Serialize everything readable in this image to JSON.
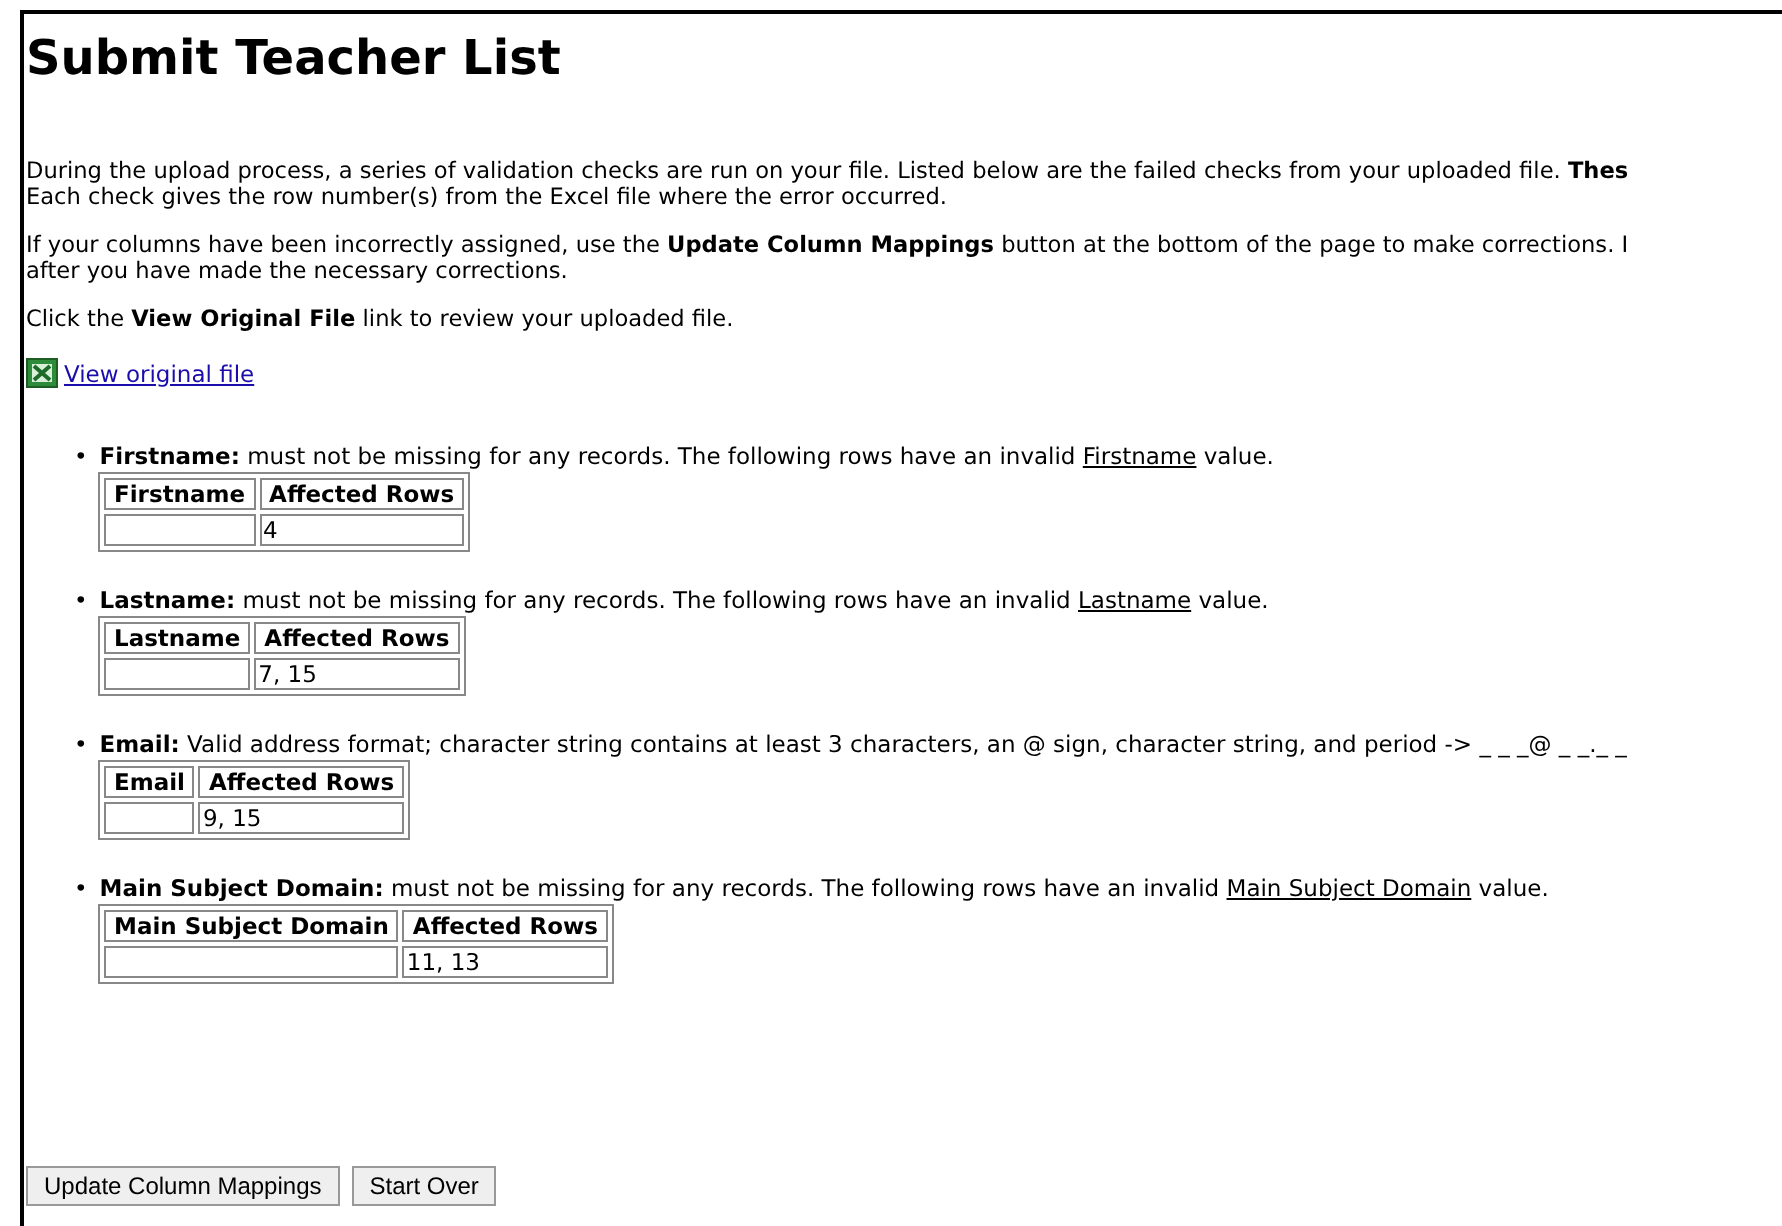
{
  "title": "Submit Teacher List",
  "paragraphs": [
    {
      "text": "During the upload process, a series of validation checks are run on your file. Listed below are the failed checks from your uploaded file. **Thes**\nEach check gives the row number(s) from the Excel file where the error occurred."
    },
    {
      "text": "If your columns have been incorrectly assigned, use the **Update Column Mappings** button at the bottom of the page to make corrections. I\nafter you have made the necessary corrections."
    },
    {
      "text": "Click the **View Original File** link to review your uploaded file."
    }
  ],
  "file_link": {
    "label": "View original file"
  },
  "checks": [
    {
      "marker": "•",
      "field": "Firstname:",
      "description": "must not be missing for any records. The following rows have an invalid",
      "term": "Firstname",
      "after": "value.",
      "columns": [
        "Firstname",
        "Affected Rows"
      ],
      "rows": [
        [
          "",
          "4"
        ]
      ]
    },
    {
      "marker": "•",
      "field": "Lastname:",
      "description": "must not be missing for any records. The following rows have an invalid",
      "term": "Lastname",
      "after": "value.",
      "columns": [
        "Lastname",
        "Affected Rows"
      ],
      "rows": [
        [
          "",
          "7, 15"
        ]
      ]
    },
    {
      "marker": "•",
      "field": "Email:",
      "description": "Valid address format; character string contains at least 3 characters, an @ sign, character string, and period -> _ _ _@ _ _._ _",
      "columns": [
        "Email",
        "Affected Rows"
      ],
      "rows": [
        [
          "",
          "9, 15"
        ]
      ]
    },
    {
      "marker": "•",
      "field": "Main Subject Domain:",
      "description": "must not be missing for any records. The following rows have an invalid",
      "term": "Main Subject Domain",
      "after": "value.",
      "columns": [
        "Main Subject Domain",
        "Affected Rows"
      ],
      "rows": [
        [
          "",
          "11, 13"
        ]
      ]
    }
  ],
  "buttons": [
    "Update Column Mappings",
    "Start Over"
  ]
}
